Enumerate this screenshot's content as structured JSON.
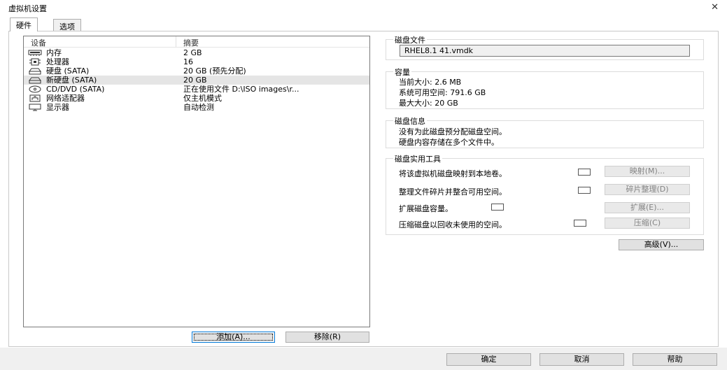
{
  "window": {
    "title": "虚拟机设置",
    "close_glyph": "✕"
  },
  "tabs": [
    {
      "label": "硬件",
      "active": true
    },
    {
      "label": "选项",
      "active": false
    }
  ],
  "device_list": {
    "columns": {
      "device": "设备",
      "summary": "摘要"
    },
    "rows": [
      {
        "icon": "memory-icon",
        "name": "内存",
        "summary": "2 GB",
        "selected": false
      },
      {
        "icon": "processor-icon",
        "name": "处理器",
        "summary": "16",
        "selected": false
      },
      {
        "icon": "hard-disk-icon",
        "name": "硬盘 (SATA)",
        "summary": "20 GB (预先分配)",
        "selected": false
      },
      {
        "icon": "hard-disk-icon",
        "name": "新硬盘 (SATA)",
        "summary": "20 GB",
        "selected": true
      },
      {
        "icon": "cd-dvd-icon",
        "name": "CD/DVD (SATA)",
        "summary": "正在使用文件 D:\\ISO images\\r...",
        "selected": false
      },
      {
        "icon": "network-adapter-icon",
        "name": "网络适配器",
        "summary": "仅主机模式",
        "selected": false
      },
      {
        "icon": "display-icon",
        "name": "显示器",
        "summary": "自动检测",
        "selected": false
      }
    ]
  },
  "list_buttons": {
    "add": "添加(A)...",
    "remove": "移除(R)"
  },
  "disk_file": {
    "title": "磁盘文件",
    "value": "RHEL8.1 41.vmdk"
  },
  "capacity": {
    "title": "容量",
    "current_size": "当前大小: 2.6 MB",
    "system_free": "系统可用空间: 791.6 GB",
    "max_size": "最大大小: 20 GB"
  },
  "disk_info": {
    "title": "磁盘信息",
    "line1": "没有为此磁盘预分配磁盘空间。",
    "line2": "硬盘内容存储在多个文件中。"
  },
  "disk_utilities": {
    "title": "磁盘实用工具",
    "items": [
      {
        "desc": "将该虚拟机磁盘映射到本地卷。",
        "button": "映射(M)..."
      },
      {
        "desc": "整理文件碎片并整合可用空间。",
        "button": "碎片整理(D)"
      },
      {
        "desc": "扩展磁盘容量。",
        "button": "扩展(E)..."
      },
      {
        "desc": "压缩磁盘以回收未使用的空间。",
        "button": "压缩(C)"
      }
    ]
  },
  "advanced_button": "高级(V)...",
  "footer": {
    "ok": "确定",
    "cancel": "取消",
    "help": "帮助"
  }
}
